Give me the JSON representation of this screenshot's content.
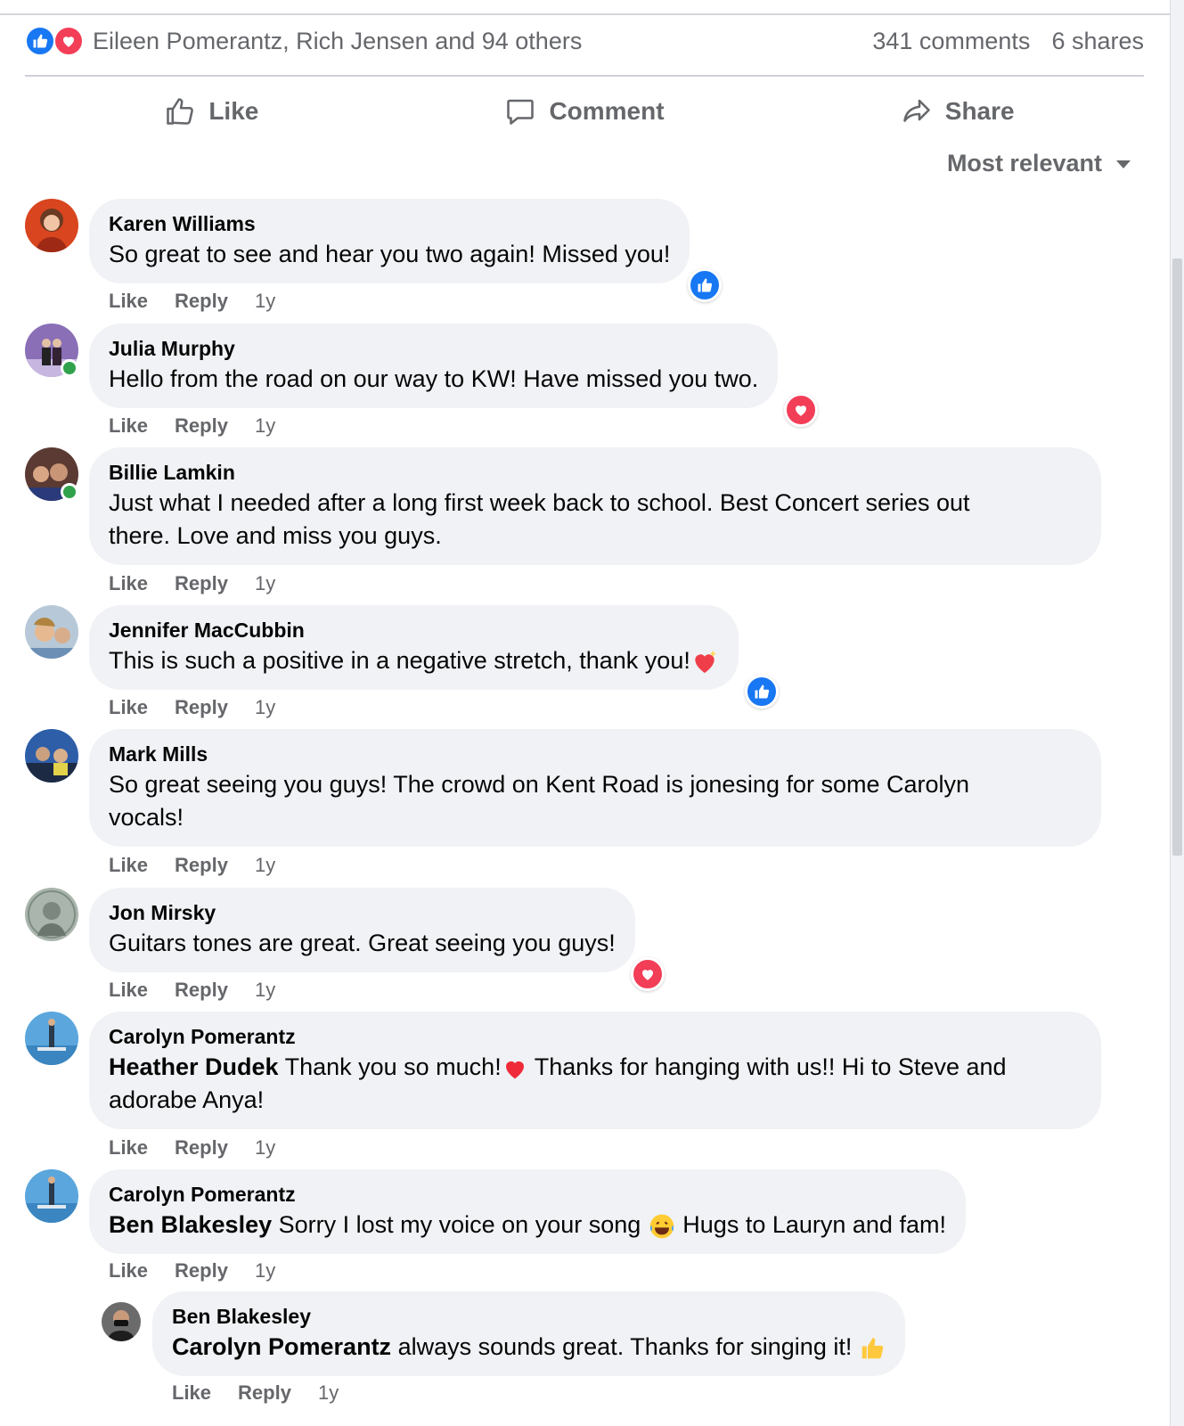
{
  "summary": {
    "reactors": "Eileen Pomerantz, Rich Jensen and 94 others",
    "comments": "341 comments",
    "shares": "6 shares"
  },
  "actions": {
    "like": "Like",
    "comment": "Comment",
    "share": "Share"
  },
  "sort": {
    "label": "Most relevant"
  },
  "comment_meta": {
    "like": "Like",
    "reply": "Reply",
    "time": "1y"
  },
  "comments": [
    {
      "author": "Karen Williams",
      "text": "So great to see and hear you two again! Missed you!",
      "reaction": "like"
    },
    {
      "author": "Julia Murphy",
      "text": "Hello from the road on our way to KW! Have missed you two.",
      "reaction": "love"
    },
    {
      "author": "Billie Lamkin",
      "text_line1": "Just what I needed after a long first week back to school. Best Concert series out",
      "text_line2": "there. Love and miss you guys."
    },
    {
      "author": "Jennifer MacCubbin",
      "text": "This is such a positive in a negative stretch, thank you!",
      "reaction": "like"
    },
    {
      "author": "Mark Mills",
      "text_line1": "So great seeing you guys! The crowd on Kent Road is jonesing for some Carolyn",
      "text_line2": "vocals!"
    },
    {
      "author": "Jon Mirsky",
      "text": "Guitars tones are great. Great seeing you guys!",
      "reaction": "love"
    },
    {
      "author": "Carolyn Pomerantz",
      "mention": "Heather Dudek",
      "text_a": " Thank you so much!",
      "text_b": " Thanks for hanging with us!! Hi to Steve and",
      "text_line2": "adorabe Anya!"
    },
    {
      "author": "Carolyn Pomerantz",
      "mention": "Ben Blakesley",
      "text_a": " Sorry I lost my voice on your song ",
      "text_b": " Hugs to Lauryn and fam!"
    },
    {
      "author": "Ben Blakesley",
      "mention": "Carolyn Pomerantz",
      "text_a": " always sounds great. Thanks for singing it! "
    }
  ]
}
